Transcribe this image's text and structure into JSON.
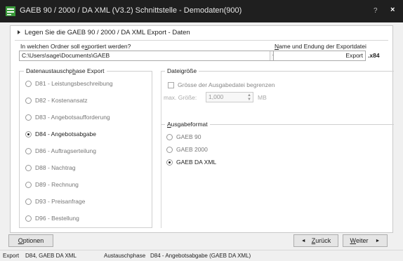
{
  "window": {
    "title": "GAEB 90 / 2000 / DA XML (V3.2) Schnittstelle - Demodaten(900)",
    "help": "?",
    "close": "×"
  },
  "banner": "Legen Sie die GAEB 90 / 2000 / DA XML Export - Daten",
  "folder": {
    "label_pre": "In welchen Ordner soll e",
    "label_u": "x",
    "label_post": "portiert werden?",
    "value": "C:\\Users\\sage\\Documents\\GAEB"
  },
  "filename": {
    "label_u": "N",
    "label_post": "ame und Endung der Exportdatei",
    "value": "Export",
    "extension": ".x84"
  },
  "phase": {
    "title_pre": "Datenaustauschp",
    "title_u": "h",
    "title_post": "ase Export",
    "options": [
      {
        "label": "D81 - Leistungsbeschreibung",
        "checked": false
      },
      {
        "label": "D82 - Kostenansatz",
        "checked": false
      },
      {
        "label": "D83 - Angebotsaufforderung",
        "checked": false
      },
      {
        "label": "D84 - Angebotsabgabe",
        "checked": true
      },
      {
        "label": "D86 - Auftragserteilung",
        "checked": false
      },
      {
        "label": "D88 - Nachtrag",
        "checked": false
      },
      {
        "label": "D89 - Rechnung",
        "checked": false
      },
      {
        "label": "D93 - Preisanfrage",
        "checked": false
      },
      {
        "label": "D96 - Bestellung",
        "checked": false
      }
    ]
  },
  "filesize": {
    "title": "Dateigröße",
    "checkbox_label": "Grösse der Ausgabedatei begrenzen",
    "max_label": "max. Größe:",
    "max_value": "1,000",
    "unit": "MB"
  },
  "format": {
    "title_u": "A",
    "title_post": "usgabeformat",
    "options": [
      {
        "label": "GAEB 90",
        "checked": false
      },
      {
        "label": "GAEB 2000",
        "checked": false
      },
      {
        "label": "GAEB DA XML",
        "checked": true
      }
    ]
  },
  "buttons": {
    "options_u": "O",
    "options_post": "ptionen",
    "back_arrow": "◄",
    "back_u": "Z",
    "back_post": "urück",
    "next_u": "W",
    "next_post": "eiter",
    "next_arrow": "►"
  },
  "status": {
    "export_label": "Export",
    "export_value": "D84, GAEB DA XML",
    "phase_label": "Austauschphase",
    "phase_value": "D84 - Angebotsabgabe (GAEB DA XML)"
  },
  "colors": {
    "titlebar": "#1f1f1f",
    "icon_green": "#3a9a3a"
  }
}
